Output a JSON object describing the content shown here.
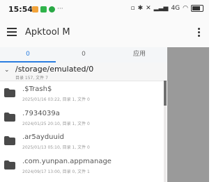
{
  "status": {
    "time": "15:54",
    "notif_more": "···",
    "network": "4G",
    "battery_icon": "battery-icon"
  },
  "toolbar": {
    "title": "Apktool M",
    "menu_icon": "hamburger-icon",
    "overflow_icon": "more-vert-icon"
  },
  "tabs": [
    {
      "label": "0",
      "active": true
    },
    {
      "label": "0",
      "active": false
    },
    {
      "label": "应用",
      "active": false
    }
  ],
  "path": {
    "current": "/storage/emulated/0",
    "summary": "目录 157, 文件 7"
  },
  "files": [
    {
      "name": ".$Trash$",
      "meta": "2025/01/16 03:22, 目录 1, 文件 0"
    },
    {
      "name": ".7934039a",
      "meta": "2024/01/25 20:10, 目录 1, 文件 0"
    },
    {
      "name": ".ar5ayduuid",
      "meta": "2025/01/13 05:10, 目录 1, 文件 0"
    },
    {
      "name": ".com.yunpan.appmanage",
      "meta": "2024/09/17 13:00, 目录 0, 文件 1"
    }
  ],
  "colors": {
    "accent": "#2a7de0",
    "scrim": "#9a9a9a"
  }
}
